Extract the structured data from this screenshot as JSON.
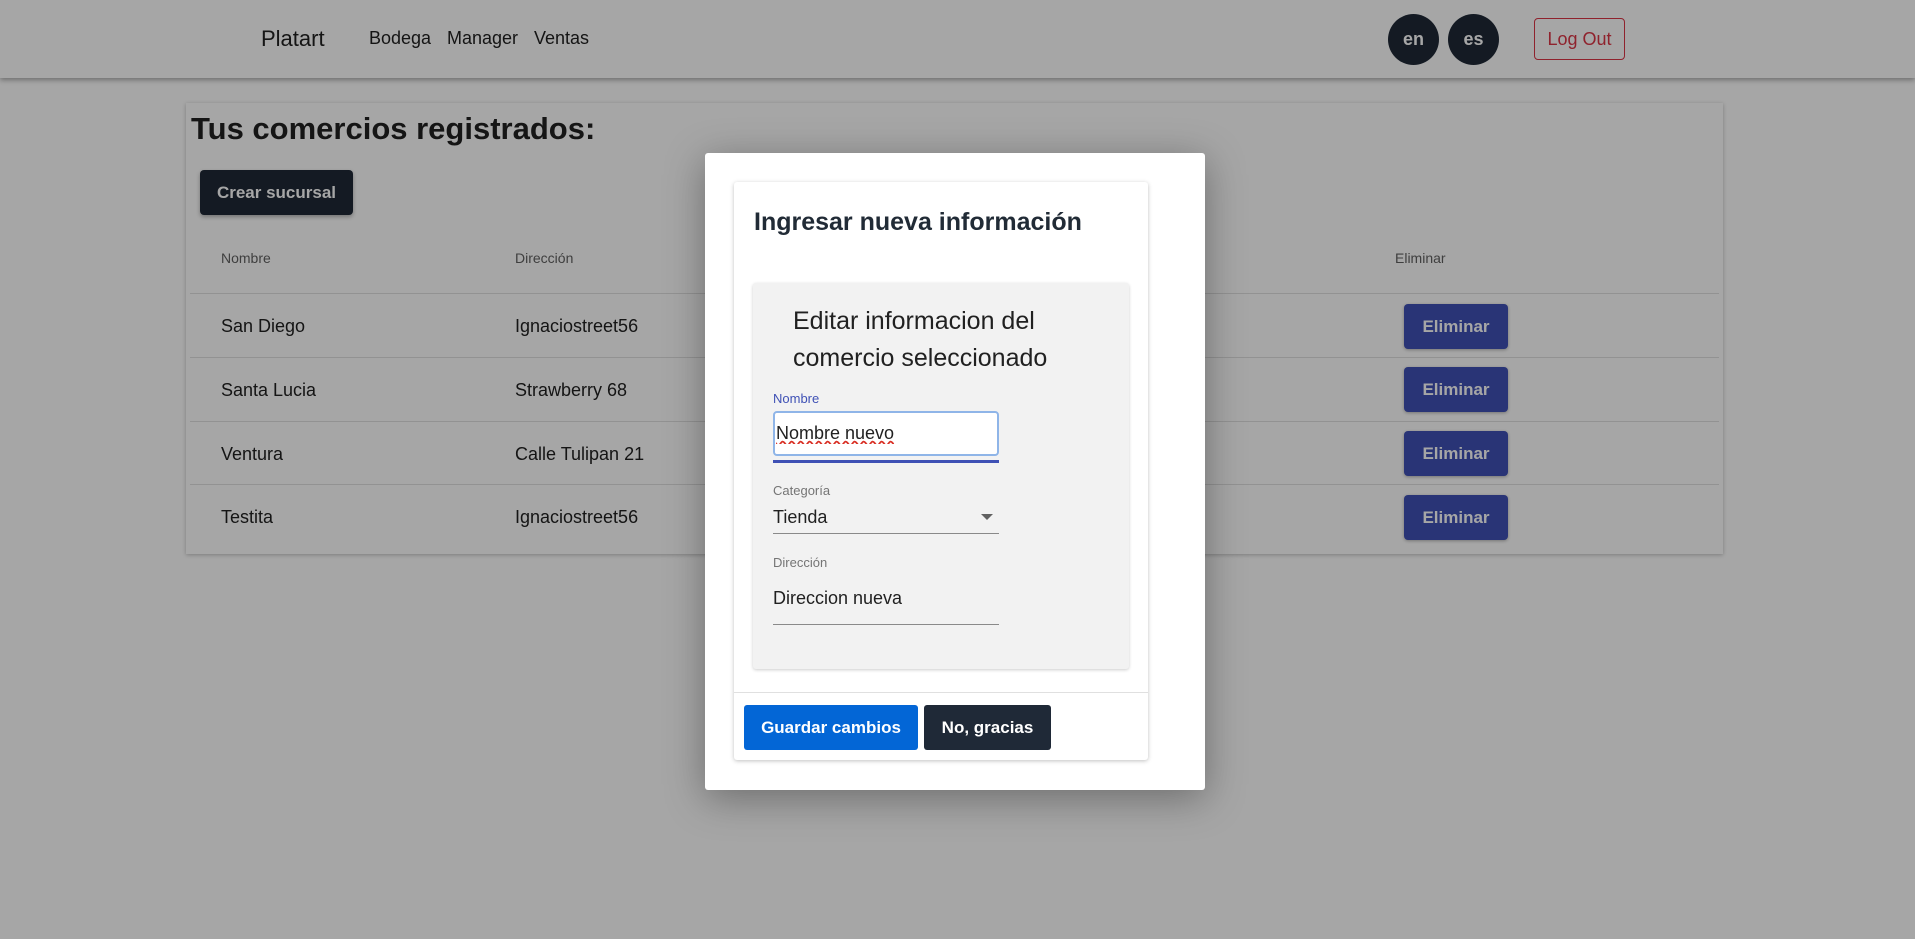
{
  "navbar": {
    "brand": "Platart",
    "links": [
      "Bodega",
      "Manager",
      "Ventas"
    ],
    "languages": [
      "en",
      "es"
    ],
    "logout_label": "Log Out"
  },
  "page": {
    "title": "Tus comercios registrados:",
    "create_button_label": "Crear sucursal",
    "table": {
      "headers": [
        "Nombre",
        "Dirección",
        "Eliminar"
      ],
      "rows": [
        {
          "nombre": "San Diego",
          "direccion": "Ignaciostreet56",
          "action": "Eliminar"
        },
        {
          "nombre": "Santa Lucia",
          "direccion": "Strawberry 68",
          "action": "Eliminar"
        },
        {
          "nombre": "Ventura",
          "direccion": "Calle Tulipan 21",
          "action": "Eliminar"
        },
        {
          "nombre": "Testita",
          "direccion": "Ignaciostreet56",
          "action": "Eliminar"
        }
      ]
    }
  },
  "modal": {
    "title": "Ingresar nueva información",
    "form_title": "Editar informacion del comercio seleccionado",
    "fields": {
      "nombre": {
        "label": "Nombre",
        "value": "Nombre nuevo"
      },
      "categoria": {
        "label": "Categoría",
        "value": "Tienda"
      },
      "direccion": {
        "label": "Dirección",
        "value": "Direccion nueva"
      }
    },
    "save_label": "Guardar cambios",
    "cancel_label": "No, gracias"
  },
  "colors": {
    "dark": "#1f2937",
    "indigo": "#3f51b5",
    "primary_blue": "#0366d6",
    "danger": "#dc3545"
  }
}
